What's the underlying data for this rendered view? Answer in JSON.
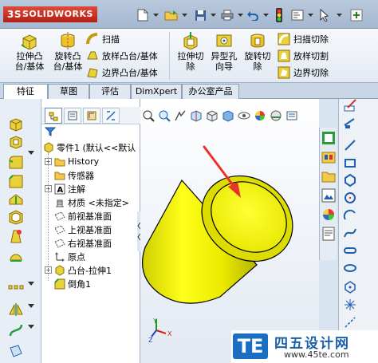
{
  "app": {
    "logo_text": "SOLIDWORKS",
    "logo_prefix": "3S"
  },
  "ribbon": {
    "extrude_boss": "拉伸凸\n台/基体",
    "revolve_boss": "旋转凸\n台/基体",
    "sweep": "扫描",
    "loft_boss": "放样凸台/基体",
    "boundary_boss": "边界凸台/基体",
    "extrude_cut": "拉伸切\n除",
    "hole_wizard": "异型孔\n向导",
    "revolve_cut": "旋转切\n除",
    "sweep_cut": "扫描切除",
    "loft_cut": "放样切割",
    "boundary_cut": "边界切除"
  },
  "tabs": [
    "特征",
    "草图",
    "评估",
    "DimXpert",
    "办公室产品"
  ],
  "tree": {
    "root": "零件1 (默认<<默认",
    "items": [
      "History",
      "传感器",
      "注解",
      "材质 <未指定>",
      "前视基准面",
      "上视基准面",
      "右视基准面",
      "原点",
      "凸台-拉伸1",
      "倒角1"
    ]
  },
  "triad": {
    "x": "X",
    "y": "Y",
    "z": "Z"
  },
  "watermark": {
    "badge": "TE",
    "name": "四五设计网",
    "url": "www.45te.com"
  },
  "colors": {
    "model": "#e8e800",
    "arrow": "#e8322a",
    "watermark": "#1a6fc2"
  }
}
